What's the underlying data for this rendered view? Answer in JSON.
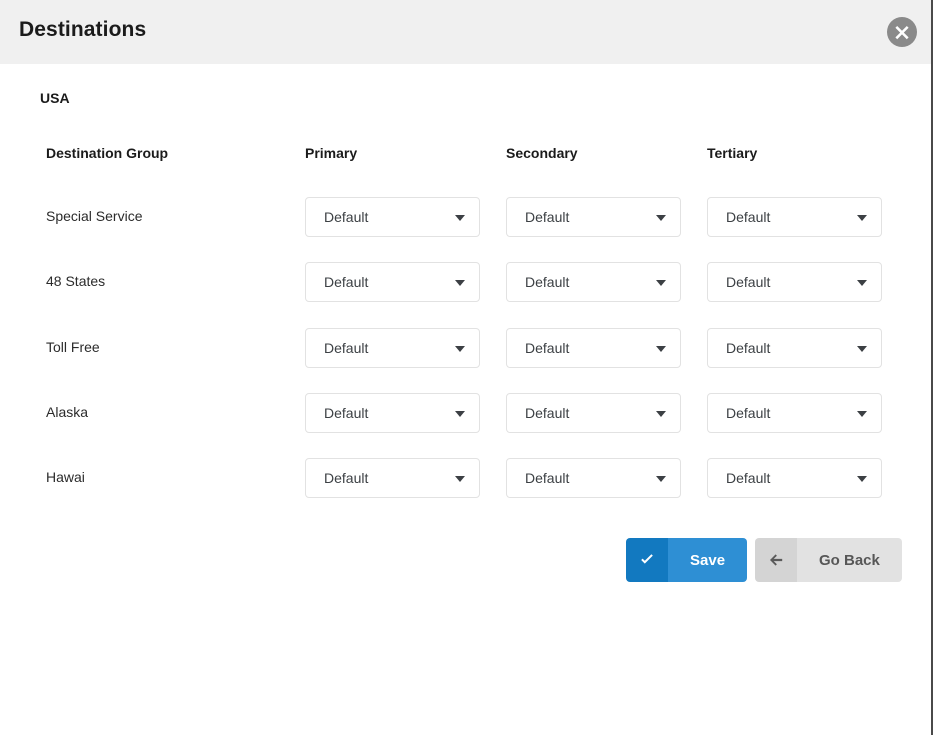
{
  "window": {
    "title": "Destinations",
    "close_icon": "close-circle-icon"
  },
  "body": {
    "country_label": "USA"
  },
  "table": {
    "columns": [
      "Destination Group",
      "Primary",
      "Secondary",
      "Tertiary"
    ],
    "rows": [
      {
        "group": "Special Service",
        "primary": "Default",
        "secondary": "Default",
        "tertiary": "Default"
      },
      {
        "group": "48 States",
        "primary": "Default",
        "secondary": "Default",
        "tertiary": "Default"
      },
      {
        "group": "Toll Free",
        "primary": "Default",
        "secondary": "Default",
        "tertiary": "Default"
      },
      {
        "group": "Alaska",
        "primary": "Default",
        "secondary": "Default",
        "tertiary": "Default"
      },
      {
        "group": "Hawai",
        "primary": "Default",
        "secondary": "Default",
        "tertiary": "Default"
      }
    ]
  },
  "actions": {
    "save": {
      "label": "Save",
      "icon": "check-icon"
    },
    "go_back": {
      "label": "Go Back",
      "icon": "arrow-left-icon"
    }
  },
  "colors": {
    "header_bg": "#f0f0f0",
    "save_blue": "#2e8fd4",
    "save_blue_dark": "#1279c0",
    "go_back_gray": "#e2e2e2",
    "go_back_gray_dark": "#d4d4d4",
    "select_border": "#e2e2e2",
    "close_gray": "#8a8a8a"
  }
}
